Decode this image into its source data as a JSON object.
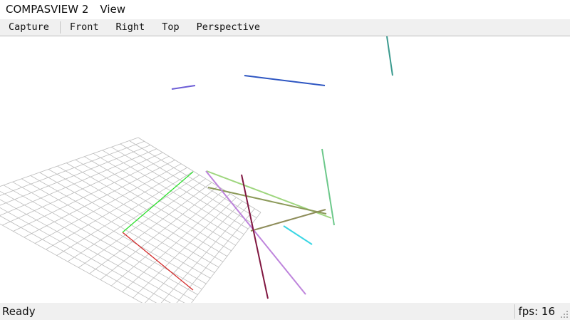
{
  "menubar": {
    "app_title": "COMPASVIEW 2",
    "view_label": "View"
  },
  "toolbar": {
    "capture_label": "Capture",
    "front_label": "Front",
    "right_label": "Right",
    "top_label": "Top",
    "perspective_label": "Perspective"
  },
  "status": {
    "text": "Ready",
    "fps_label": "fps:",
    "fps_value": "16"
  },
  "colors": {
    "axis_x": "#d42a2a",
    "axis_y": "#2ee02e",
    "grid": "#bcbcbc",
    "toolbar_bg": "#f0f0f0"
  },
  "icons": {
    "size_grip": "size-grip-icon"
  }
}
